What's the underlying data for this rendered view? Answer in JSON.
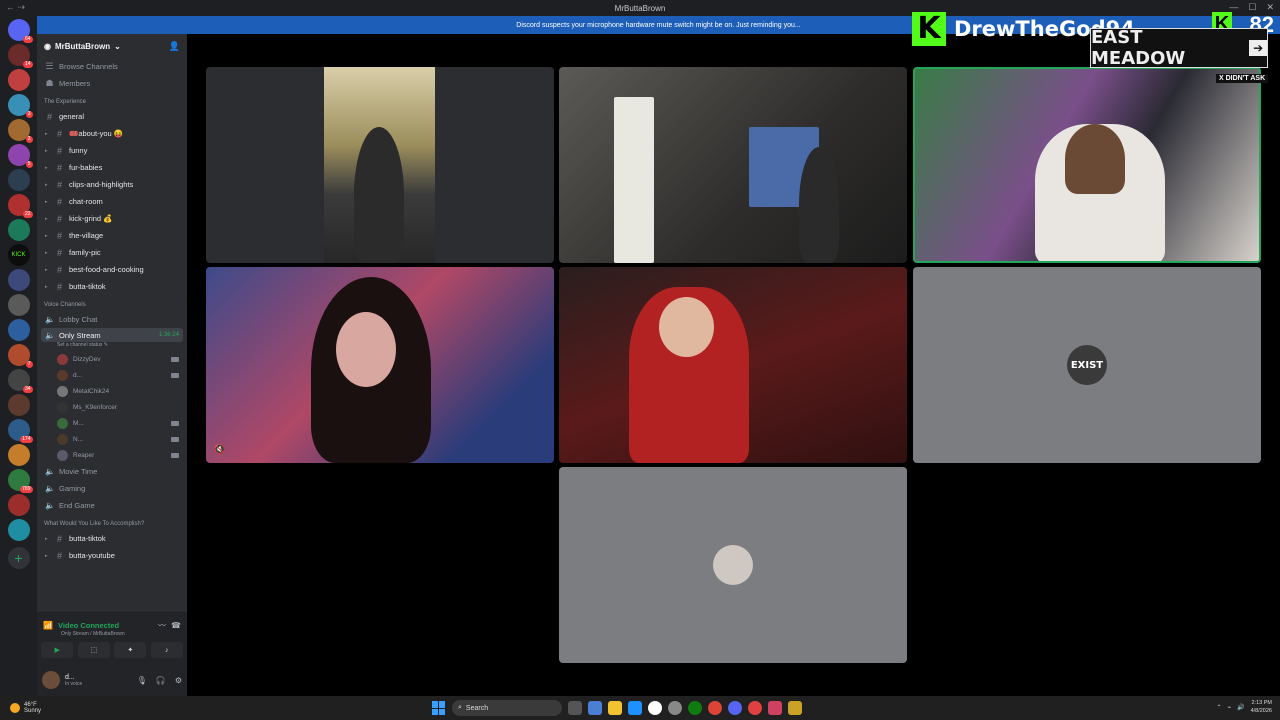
{
  "window": {
    "title": "MrButtaBrown"
  },
  "banner": {
    "text": "Discord suspects your microphone hardware mute switch might be on. Just reminding you..."
  },
  "server": {
    "name": "MrButtaBrown"
  },
  "nav": [
    {
      "label": "Browse Channels"
    },
    {
      "label": "Members"
    }
  ],
  "categories": {
    "experience": "The Experience",
    "voice": "Voice Channels",
    "accomplish": "What Would You Like To Accomplish?"
  },
  "text_channels": [
    {
      "label": "general"
    },
    {
      "label": "🎟️about-you 😝"
    },
    {
      "label": "funny"
    },
    {
      "label": "fur-babies"
    },
    {
      "label": "clips-and-highlights"
    },
    {
      "label": "chat-room"
    },
    {
      "label": "kick-grind 💰"
    },
    {
      "label": "the-village"
    },
    {
      "label": "family-pic"
    },
    {
      "label": "best-food-and-cooking"
    },
    {
      "label": "butta-tiktok"
    }
  ],
  "voice_channels": {
    "lobby": "Lobby Chat",
    "active": {
      "label": "Only Stream",
      "time": "1:36:24",
      "status": "Set a channel status ✎"
    },
    "users": [
      "DizzyDev",
      "d...",
      "MetalChik24",
      "Ms_K9enforcer",
      "M...",
      "N...",
      "Reaper"
    ],
    "others": [
      "Movie Time",
      "Gaming",
      "End Game"
    ]
  },
  "accomplish_channels": [
    {
      "label": "butta-tiktok"
    },
    {
      "label": "butta-youtube"
    }
  ],
  "voice_connection": {
    "title": "Video Connected",
    "sub": "Only Stream / MrButtaBrown"
  },
  "user_panel": {
    "name": "d...",
    "status": "In voice"
  },
  "video_tiles": {
    "exist_avatar": "EXIST"
  },
  "stream_overlay": {
    "channel": "DrewTheGod94",
    "viewers": "82",
    "k_logo": "K",
    "sign": "EAST MEADOW",
    "sign_arrow": "➔",
    "tag": "X DIDN'T ASK"
  },
  "taskbar": {
    "weather_temp": "46°F",
    "weather_desc": "Sunny",
    "search": "Search",
    "time": "2:13 PM",
    "date": "4/8/2026"
  }
}
